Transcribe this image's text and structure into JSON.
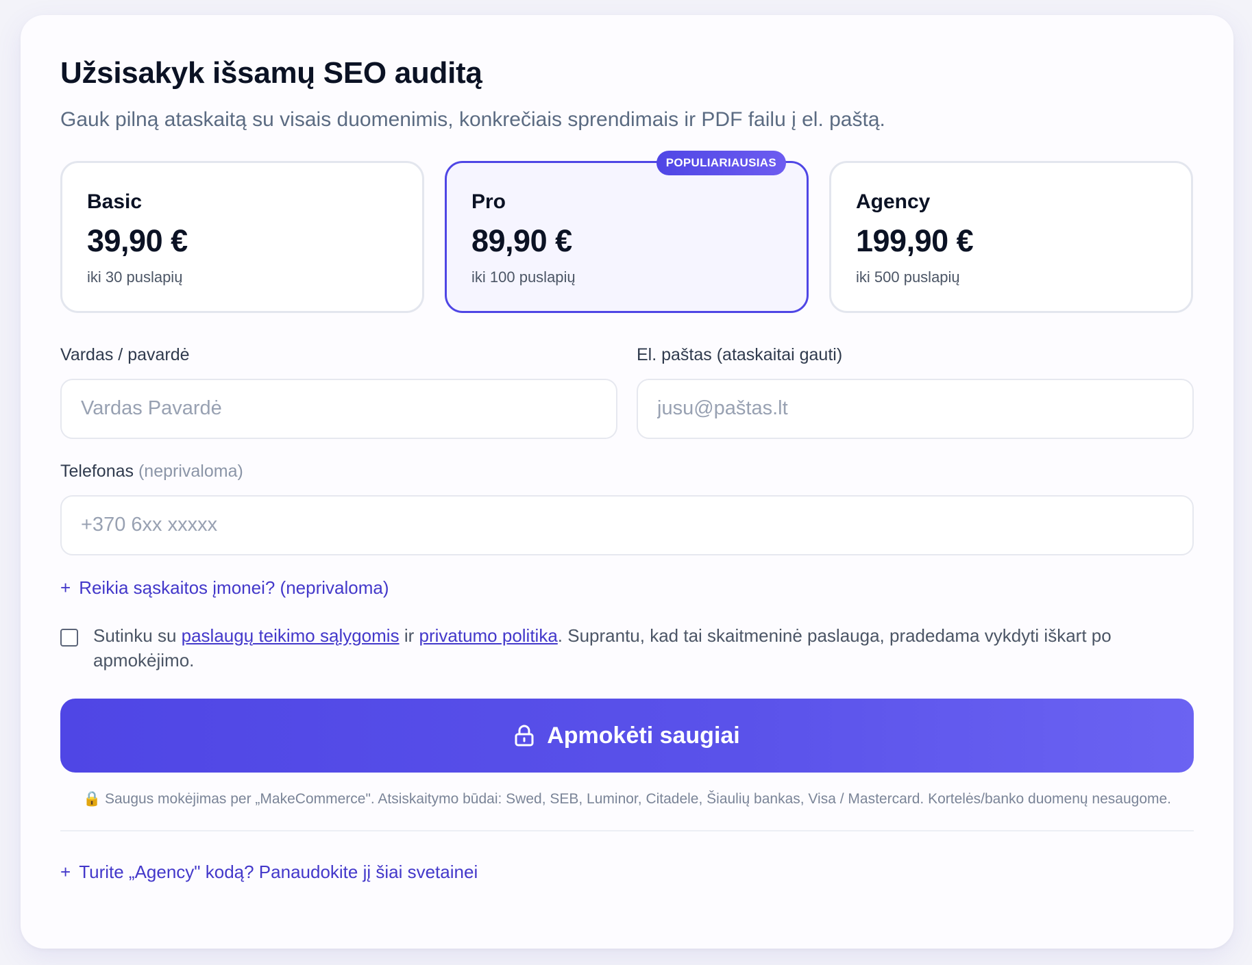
{
  "header": {
    "title": "Užsisakyk išsamų SEO auditą",
    "subtitle": "Gauk pilną ataskaitą su visais duomenimis, konkrečiais sprendimais ir PDF failu į el. paštą."
  },
  "plans": [
    {
      "name": "Basic",
      "price": "39,90 €",
      "pages": "iki 30 puslapių"
    },
    {
      "name": "Pro",
      "price": "89,90 €",
      "pages": "iki 100 puslapių",
      "badge": "POPULIARIAUSIAS"
    },
    {
      "name": "Agency",
      "price": "199,90 €",
      "pages": "iki 500 puslapių"
    }
  ],
  "form": {
    "name_label": "Vardas / pavardė",
    "name_placeholder": "Vardas Pavardė",
    "email_label": "El. paštas (ataskaitai gauti)",
    "email_placeholder": "jusu@paštas.lt",
    "phone_label": "Telefonas",
    "phone_optional": "(neprivaloma)",
    "phone_placeholder": "+370 6xx xxxxx",
    "invoice_link": "Reikia sąskaitos įmonei? (neprivaloma)",
    "plus_sign": "+"
  },
  "consent": {
    "prefix": "Sutinku su",
    "terms_link": "paslaugų teikimo sąlygomis",
    "and": "ir",
    "privacy_link": "privatumo politika",
    "suffix": ". Suprantu, kad tai skaitmeninė paslauga, pradedama vykdyti iškart po apmokėjimo."
  },
  "pay_button": {
    "label": "Apmokėti saugiai"
  },
  "secure_note": {
    "icon": "🔒",
    "text": "Saugus mokėjimas per „MakeCommerce\". Atsiskaitymo būdai: Swed, SEB, Luminor, Citadele, Šiaulių bankas, Visa / Mastercard. Kortelės/banko duomenų nesaugome."
  },
  "agency_code": {
    "label": "Turite „Agency\" kodą? Panaudokite jį šiai svetainei"
  },
  "colors": {
    "accent": "#4f46e5",
    "link": "#4338ca"
  }
}
